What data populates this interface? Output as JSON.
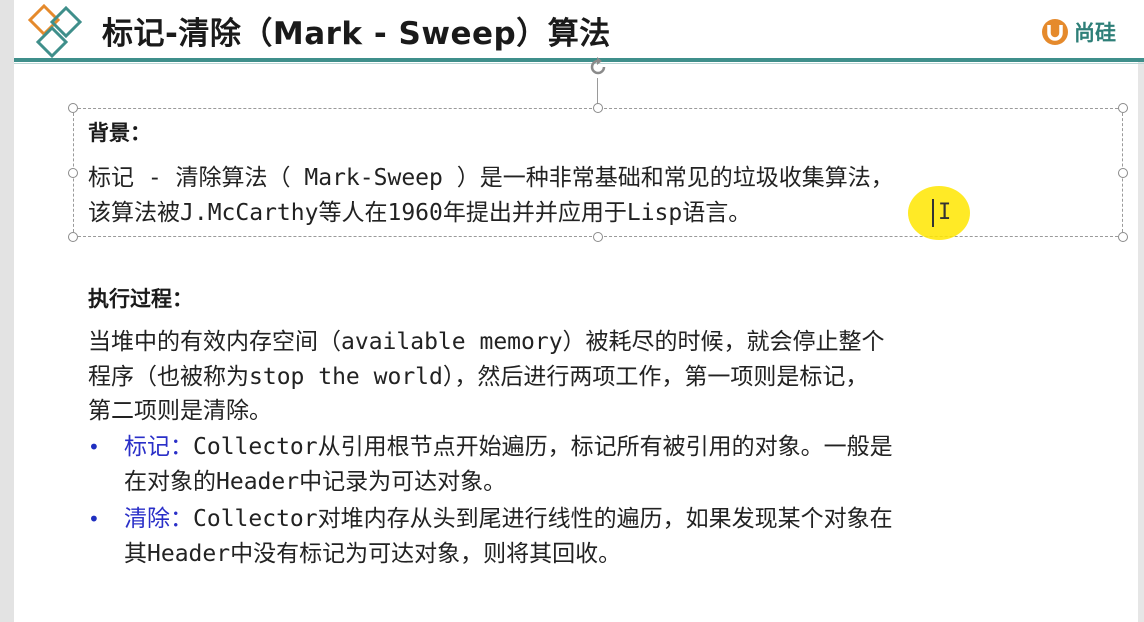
{
  "header": {
    "title": "标记-清除（Mark - Sweep）算法",
    "brand_text": "尚硅",
    "logo_icon": "diamond-logo-icon",
    "brand_icon": "u-brand-icon",
    "accent_color": "#3f8f8b"
  },
  "background_box": {
    "heading": "背景：",
    "line1": "标记 - 清除算法（ Mark-Sweep ）是一种非常基础和常见的垃圾收集算法，",
    "line2": "该算法被J.McCarthy等人在1960年提出并并应用于Lisp语言。",
    "ibeam": "I"
  },
  "process": {
    "heading": "执行过程：",
    "line1": "当堆中的有效内存空间（available memory）被耗尽的时候，就会停止整个",
    "line2": "程序（也被称为stop the world），然后进行两项工作，第一项则是标记，",
    "line3": "第二项则是清除。",
    "bullets": [
      {
        "marker": "•",
        "keyword": "标记：",
        "line1": "Collector从引用根节点开始遍历，标记所有被引用的对象。一般是",
        "line2": "在对象的Header中记录为可达对象。"
      },
      {
        "marker": "•",
        "keyword": "清除：",
        "line1": "Collector对堆内存从头到尾进行线性的遍历，如果发现某个对象在",
        "line2": "其Header中没有标记为可达对象，则将其回收。"
      }
    ],
    "keyword_color": "#2a2fc8"
  }
}
